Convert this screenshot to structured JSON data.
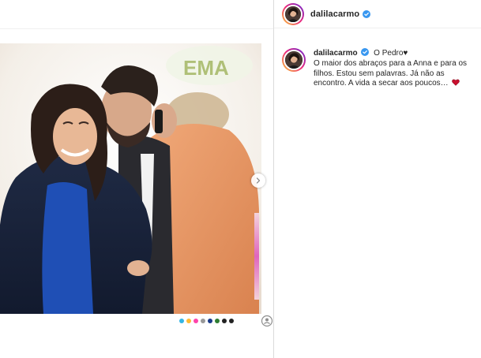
{
  "header": {
    "username": "dalilacarmo",
    "verified": true
  },
  "caption": {
    "username": "dalilacarmo",
    "text": "O Pedro♥\nO maior dos abraços para a Anna e para os filhos. Estou sem palavras. Já não as encontro. A vida a secar aos poucos…",
    "end_emoji": "heart-icon"
  },
  "photo": {
    "background_sign_text": "EMA",
    "carousel_dot_colors": [
      "#33b5e5",
      "#ffbb33",
      "#ff44aa",
      "#999999",
      "#1a3a8a",
      "#2e7d32",
      "#222222",
      "#222222"
    ]
  },
  "colors": {
    "verified_blue": "#3897f0",
    "heart_red": "#c8102e",
    "divider": "#dbdbdb"
  }
}
